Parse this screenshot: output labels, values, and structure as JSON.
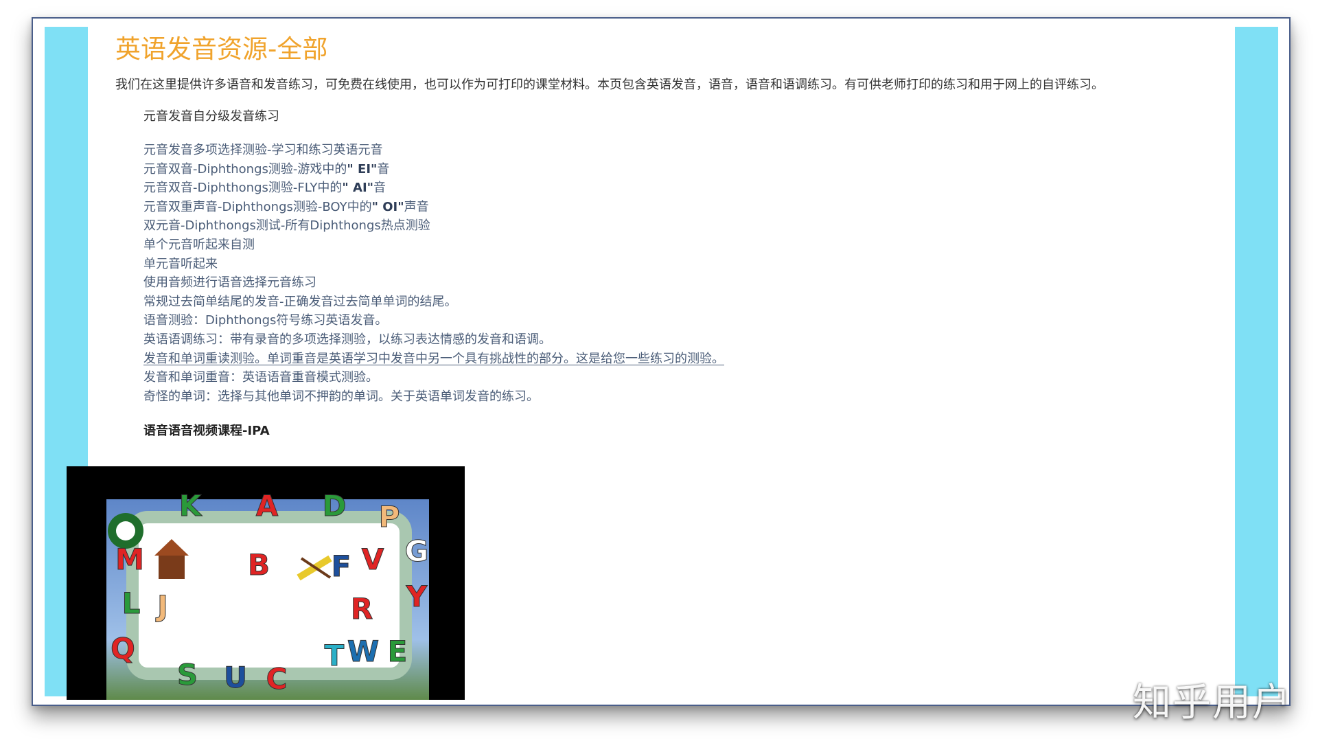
{
  "page": {
    "title": "英语发音资源-全部",
    "intro": "我们在这里提供许多语音和发音练习，可免费在线使用，也可以作为可打印的课堂材料。本页包含英语发音，语音，语音和语调练习。有可供老师打印的练习和用于网上的自评练习。",
    "section_heading": "元音发音自分级发音练习",
    "links": [
      {
        "pre": "元音发音多项选择测验-学习和练习英语元音",
        "bold": "",
        "post": "",
        "underlined": false
      },
      {
        "pre": "元音双音-Diphthongs测验-游戏中的",
        "bold": "\" EI\"",
        "post": "音",
        "underlined": false
      },
      {
        "pre": "元音双音-Diphthongs测验-FLY中的",
        "bold": "\" AI\"",
        "post": "音",
        "underlined": false
      },
      {
        "pre": "元音双重声音-Diphthongs测验-BOY中的",
        "bold": "\" OI\"",
        "post": "声音",
        "underlined": false
      },
      {
        "pre": "双元音-Diphthongs测试-所有Diphthongs热点测验",
        "bold": "",
        "post": "",
        "underlined": false
      },
      {
        "pre": "单个元音听起来自测",
        "bold": "",
        "post": "",
        "underlined": false
      },
      {
        "pre": "单元音听起来",
        "bold": "",
        "post": "",
        "underlined": false
      },
      {
        "pre": "使用音频进行语音选择元音练习",
        "bold": "",
        "post": "",
        "underlined": false
      },
      {
        "pre": "常规过去简单结尾的发音-正确发音过去简单单词的结尾。",
        "bold": "",
        "post": "",
        "underlined": false
      },
      {
        "pre": "语音测验：Diphthongs符号练习英语发音。",
        "bold": "",
        "post": "",
        "underlined": false
      },
      {
        "pre": "英语语调练习：带有录音的多项选择测验，以练习表达情感的发音和语调。",
        "bold": "",
        "post": "",
        "underlined": false
      },
      {
        "pre": "发音和单词重读测验。单词重音是英语学习中发音中另一个具有挑战性的部分。这是给您一些练习的测验。",
        "bold": "",
        "post": "",
        "underlined": true
      },
      {
        "pre": "发音和单词重音：英语语音重音模式测验。",
        "bold": "",
        "post": "",
        "underlined": false
      },
      {
        "pre": "奇怪的单词：选择与其他单词不押韵的单词。关于英语单词发音的练习。",
        "bold": "",
        "post": "",
        "underlined": false
      }
    ],
    "video_heading": "语音语音视频课程-IPA",
    "video_letters": [
      "K",
      "A",
      "D",
      "P",
      "M",
      "B",
      "F",
      "V",
      "G",
      "L",
      "J",
      "R",
      "Y",
      "Q",
      "S",
      "U",
      "C",
      "T",
      "W",
      "E"
    ]
  },
  "watermark": "知乎用户",
  "colors": {
    "title": "#f0a32c",
    "side_bar": "#7fe0f5",
    "link": "#4b5d78",
    "frame_border": "#4a5e8a"
  }
}
